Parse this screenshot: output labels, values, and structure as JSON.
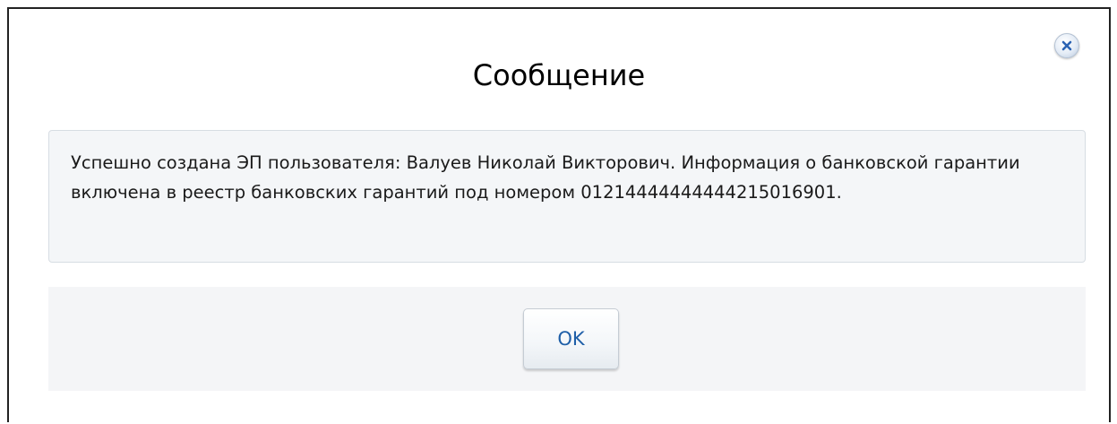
{
  "dialog": {
    "title": "Сообщение",
    "close_icon": "close-icon",
    "message": "Успешно создана ЭП пользователя: Валуев Николай Викторович. Информация о банковской гарантии включена в реестр банковских гарантий под номером 01214444444444215016901.",
    "ok_label": "OK"
  },
  "colors": {
    "ok_text": "#1f5fa8",
    "close_icon": "#2b63b3",
    "message_bg": "#f4f6f8",
    "footer_bg": "#f4f5f7"
  }
}
